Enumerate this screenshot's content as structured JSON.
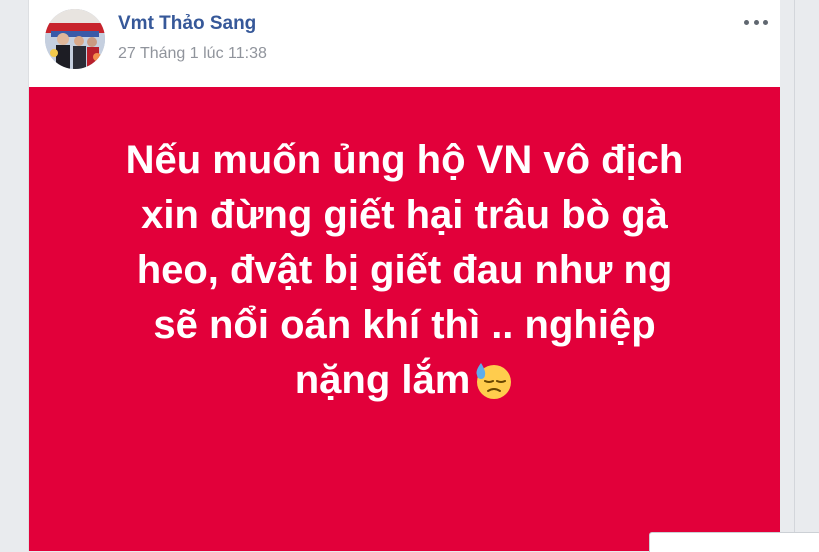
{
  "post": {
    "author_name": "Vmt Thảo Sang",
    "timestamp": "27 Tháng 1 lúc 11:38",
    "more_icon": "ellipsis-icon",
    "avatar_icon": "profile-photo",
    "body_color": "#e2003a",
    "text_lines": [
      "Nếu muốn ủng hộ VN vô địch",
      "xin đừng giết hại trâu bò gà",
      "heo, đvật bị giết đau như ng",
      "sẽ nổi oán khí thì .. nghiệp",
      "nặng lắm"
    ],
    "emoji": "downcast-face-with-sweat-icon"
  },
  "colors": {
    "page_background": "#e9ebee",
    "author_link": "#365899",
    "meta_text": "#90949c"
  }
}
